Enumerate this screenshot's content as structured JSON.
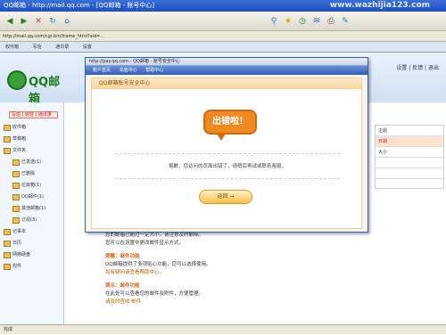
{
  "browser": {
    "title": "QQ邮箱 - http://mail.qq.com - [QQ邮箱 - 账号中心]",
    "watermark": "www.wazhijia123.com",
    "address": "http://mail.qq.com/cgi-bin/frame_html?sid=...",
    "tabs": [
      "收件箱",
      "写信",
      "通讯录",
      "设置"
    ],
    "status": "完成"
  },
  "app": {
    "logo_text": "QQ邮箱",
    "top_links": "设置 | 反馈 | 退出",
    "sidebar": {
      "compose_button": "写信 | 收信 | 通讯录",
      "items": [
        {
          "label": "收件箱"
        },
        {
          "label": "草稿箱"
        },
        {
          "label": "文件夹"
        },
        {
          "label": "已发送(1)"
        },
        {
          "label": "已删除"
        },
        {
          "label": "垃圾箱(1)"
        },
        {
          "label": "QQ邮件(1)"
        },
        {
          "label": "其他邮箱(1)"
        },
        {
          "label": "订阅(3)"
        },
        {
          "label": "记事本"
        },
        {
          "label": "日历"
        },
        {
          "label": "网络硬盘"
        },
        {
          "label": "附件"
        }
      ]
    },
    "right_table": {
      "rows": [
        "主题",
        "日期",
        "大小",
        "",
        ""
      ]
    },
    "notice": {
      "line1": "您的邮箱已超过一定大小，请注意及时删除。",
      "line2": "您可以在设置中更改邮件显示方式。",
      "section1_title": "提醒：邮件功能",
      "section1_line1": "QQ邮箱提供了多项贴心功能，您可以选择使用。",
      "section1_line2": "如有疑问请查看帮助中心。",
      "section2_title": "提示：邮件功能",
      "section2_line1": "在此处可以查看您的邮件及附件，方便管理。",
      "section2_line2": "请及时查收 邮件"
    }
  },
  "popup": {
    "window_title": "http://pay.qq.com - QQ邮箱 - 账号安全中心",
    "nav": [
      "账户首页",
      "充值中心",
      "帮助中心"
    ],
    "body_header": "QQ邮箱账号安全中心",
    "bubble_text": "出错啦！",
    "error_message": "抱歉，您访问的页面出错了，请稍后再试或联系客服。",
    "return_button": "返回 →"
  }
}
